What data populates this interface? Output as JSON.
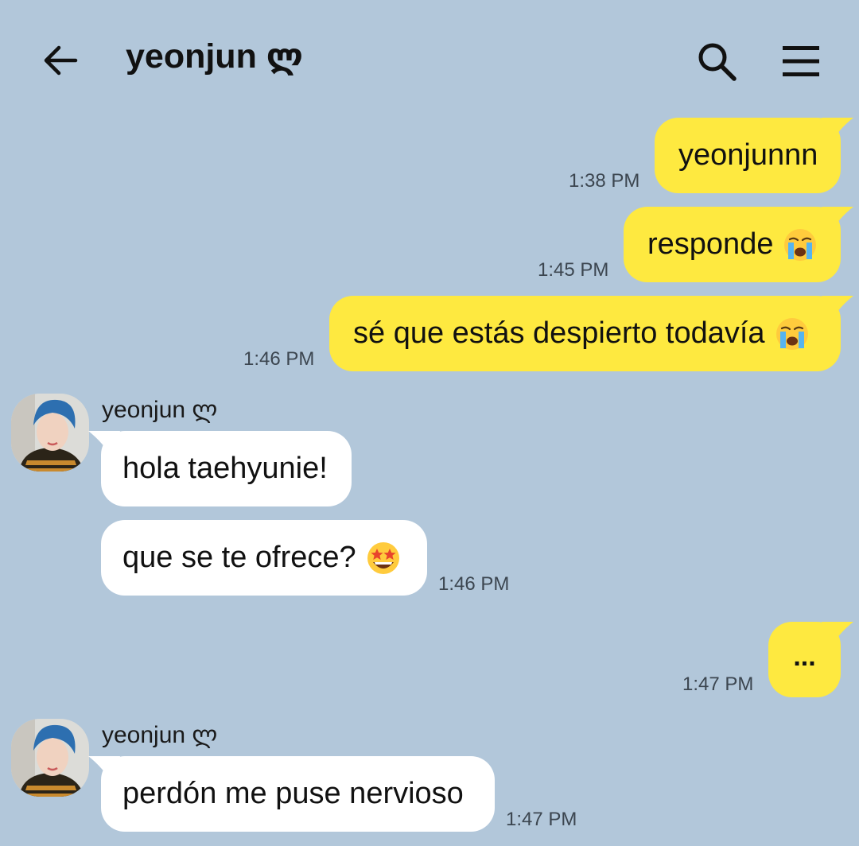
{
  "header": {
    "title": "yeonjun ლ",
    "back_icon": "arrow-left-icon",
    "search_icon": "search-icon",
    "menu_icon": "hamburger-menu-icon"
  },
  "colors": {
    "background": "#b2c7da",
    "sent_bubble": "#fee940",
    "received_bubble": "#ffffff"
  },
  "messages": [
    {
      "direction": "sent",
      "text": "yeonjunnn",
      "time": "1:38 PM"
    },
    {
      "direction": "sent",
      "text": "responde",
      "emoji": "loudly-crying-face",
      "time": "1:45 PM"
    },
    {
      "direction": "sent",
      "text": "sé que estás despierto todavía",
      "emoji": "loudly-crying-face",
      "time": "1:46 PM"
    },
    {
      "direction": "received",
      "sender": "yeonjun ლ",
      "text": "hola taehyunie!",
      "time": ""
    },
    {
      "direction": "received",
      "text": "que se te ofrece?",
      "emoji": "star-struck-face",
      "time": "1:46 PM"
    },
    {
      "direction": "sent",
      "text": "...",
      "time": "1:47 PM"
    },
    {
      "direction": "received",
      "sender": "yeonjun ლ",
      "text": "perdón me puse nervioso",
      "time": "1:47 PM"
    }
  ]
}
